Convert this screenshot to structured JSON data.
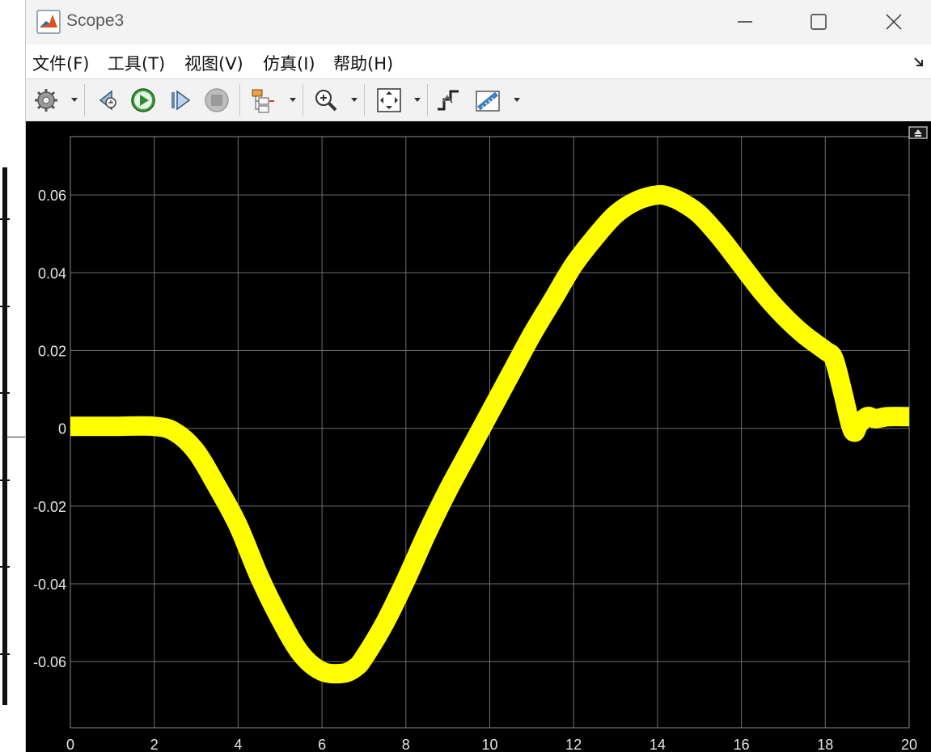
{
  "window": {
    "title": "Scope3"
  },
  "menu": [
    {
      "label": "文件(F)"
    },
    {
      "label": "工具(T)"
    },
    {
      "label": "视图(V)"
    },
    {
      "label": "仿真(I)"
    },
    {
      "label": "帮助(H)"
    }
  ],
  "toolbar": {
    "icons": [
      "gear-icon",
      "step-back-icon",
      "run-icon",
      "step-forward-icon",
      "stop-icon",
      "signal-hierarchy-icon",
      "zoom-in-icon",
      "autoscale-icon",
      "triggers-icon",
      "measurements-icon"
    ]
  },
  "colors": {
    "background": "#000000",
    "trace": "#ffff00",
    "grid": "#6e6e6e",
    "tick_text": "#e6e6e6"
  },
  "chart_data": {
    "type": "line",
    "title": "",
    "xlabel": "",
    "ylabel": "",
    "xlim": [
      0,
      20
    ],
    "ylim": [
      -0.077,
      0.075
    ],
    "xticks": [
      0,
      2,
      4,
      6,
      8,
      10,
      12,
      14,
      16,
      18,
      20
    ],
    "yticks": [
      -0.06,
      -0.04,
      -0.02,
      0,
      0.02,
      0.04,
      0.06
    ],
    "xtick_labels": [
      "0",
      "2",
      "4",
      "6",
      "8",
      "10",
      "12",
      "14",
      "16",
      "18",
      "20"
    ],
    "ytick_labels": [
      "-0.06",
      "-0.04",
      "-0.02",
      "0",
      "0.02",
      "0.04",
      "0.06"
    ],
    "grid": true,
    "series": [
      {
        "color": "#ffff00",
        "x": [
          0,
          1,
          2,
          2.5,
          3,
          3.5,
          4,
          4.5,
          5,
          5.5,
          6,
          6.5,
          6.8,
          7,
          7.5,
          8,
          8.5,
          9,
          9.5,
          10,
          10.5,
          11,
          11.5,
          12,
          12.5,
          13,
          13.5,
          14,
          14.3,
          14.6,
          15,
          15.5,
          16,
          16.5,
          17,
          17.5,
          18,
          18.2,
          18.4,
          18.6,
          18.7,
          18.8,
          19,
          19.2,
          19.5,
          20
        ],
        "y": [
          0.0005,
          0.0005,
          0.0005,
          -0.001,
          -0.006,
          -0.015,
          -0.025,
          -0.038,
          -0.049,
          -0.058,
          -0.0625,
          -0.063,
          -0.0615,
          -0.059,
          -0.05,
          -0.039,
          -0.027,
          -0.016,
          -0.006,
          0.004,
          0.014,
          0.024,
          0.033,
          0.042,
          0.049,
          0.055,
          0.0585,
          0.06,
          0.0595,
          0.058,
          0.055,
          0.049,
          0.042,
          0.035,
          0.029,
          0.024,
          0.02,
          0.018,
          0.01,
          0.001,
          -0.001,
          0.001,
          0.003,
          0.0025,
          0.003,
          0.003
        ]
      }
    ]
  }
}
